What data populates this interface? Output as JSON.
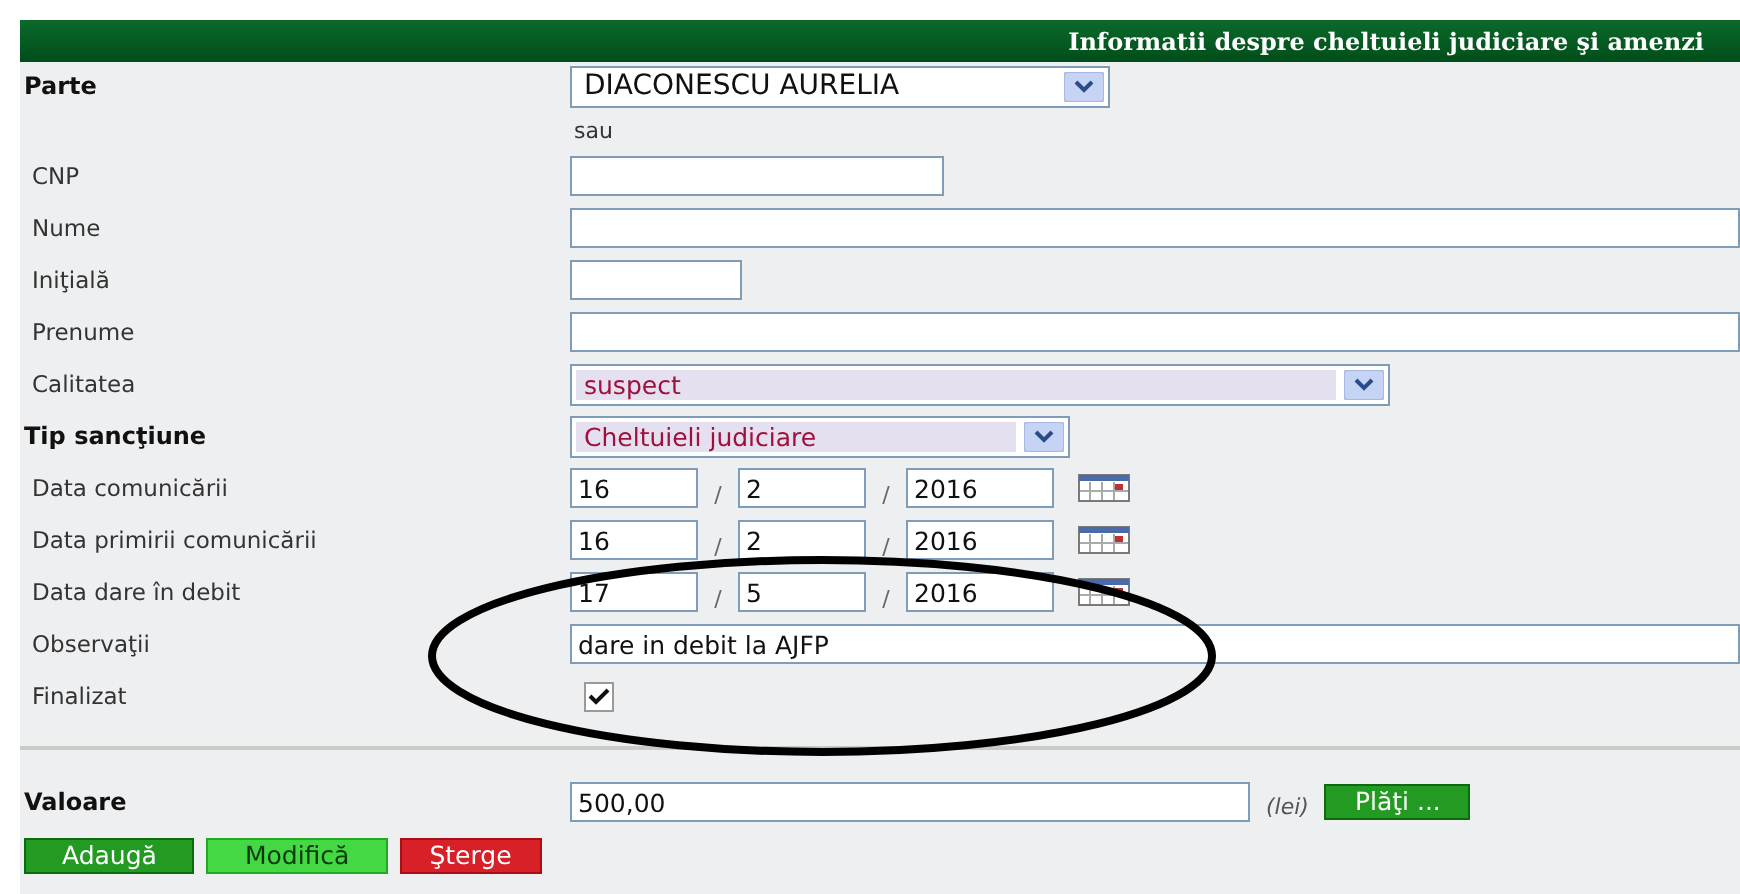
{
  "header": {
    "title": "Informatii despre cheltuieli judiciare şi amenzi"
  },
  "rows": [
    {
      "kind": "select",
      "label": "Parte",
      "bold": true,
      "value": "DIACONESCU AURELIA",
      "highlighted": false
    },
    {
      "kind": "note",
      "text": "sau"
    },
    {
      "kind": "text",
      "label": "CNP",
      "bold": false,
      "value": ""
    },
    {
      "kind": "text",
      "label": "Nume",
      "bold": false,
      "value": ""
    },
    {
      "kind": "text",
      "label": "Iniţială",
      "bold": false,
      "value": ""
    },
    {
      "kind": "text",
      "label": "Prenume",
      "bold": false,
      "value": ""
    },
    {
      "kind": "select",
      "label": "Calitatea",
      "bold": false,
      "value": "suspect",
      "highlighted": true
    },
    {
      "kind": "select",
      "label": "Tip sancţiune",
      "bold": true,
      "value": "Cheltuieli judiciare",
      "highlighted": true
    },
    {
      "kind": "date",
      "label": "Data comunicării",
      "bold": false,
      "day": "16",
      "month": "2",
      "year": "2016",
      "separator": "/"
    },
    {
      "kind": "date",
      "label": "Data primirii comunicării",
      "bold": false,
      "day": "16",
      "month": "2",
      "year": "2016",
      "separator": "/"
    },
    {
      "kind": "date",
      "label": "Data dare în debit",
      "bold": false,
      "day": "17",
      "month": "5",
      "year": "2016",
      "separator": "/"
    },
    {
      "kind": "text",
      "label": "Observaţii",
      "bold": false,
      "value": "dare in debit la AJFP"
    },
    {
      "kind": "checkbox",
      "label": "Finalizat",
      "bold": false,
      "checked": true
    }
  ],
  "valoare": {
    "label": "Valoare",
    "value": "500,00",
    "unit": "(lei)",
    "button": "Plăţi ..."
  },
  "buttons": [
    {
      "label": "Adaugă",
      "kind": "add"
    },
    {
      "label": "Modifică",
      "kind": "edit"
    },
    {
      "label": "Şterge",
      "kind": "delete"
    }
  ],
  "annotation": {
    "kind": "ellipse"
  }
}
